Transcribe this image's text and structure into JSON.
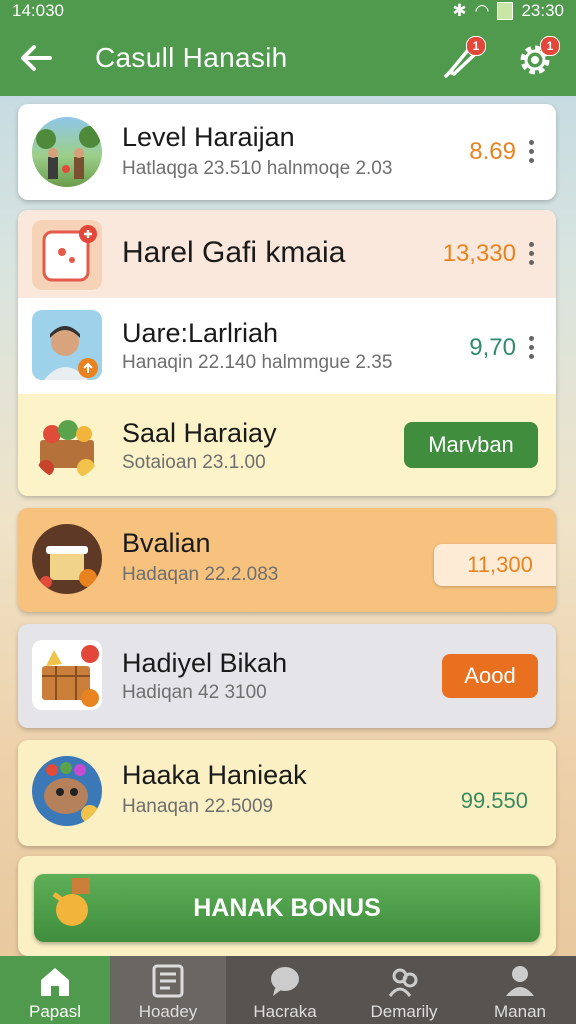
{
  "status": {
    "time": "14:030",
    "clock": "23:30"
  },
  "app": {
    "title": "Casull Hanasih"
  },
  "header_badges": {
    "bell": "1",
    "gear": "1"
  },
  "items": [
    {
      "title": "Level Haraijan",
      "subtitle": "Hatlaqga 23.510 halnmoqe 2.03",
      "value": "8.69"
    },
    {
      "title": "Harel Gafi kmaia",
      "value": "13,330"
    },
    {
      "title": "Uare:Larlriah",
      "subtitle": "Hanaqin 22.140 halmmgue 2.35",
      "value": "9,70"
    },
    {
      "title": "Saal Haraiay",
      "subtitle": "Sotaioan 23.1.00",
      "action": "Marvban"
    },
    {
      "title": "Bvalian",
      "subtitle": "Hadaqan 22.2.083",
      "value": "11,300"
    },
    {
      "title": "Hadiyel Bikah",
      "subtitle": "Hadiqan 42 3100",
      "action": "Aood"
    },
    {
      "title": "Haaka Hanieak",
      "subtitle": "Hanaqan 22.5009",
      "value": "99.550"
    }
  ],
  "bonus": {
    "label": "HANAK BONUS"
  },
  "nav": [
    {
      "label": "Papasl",
      "icon": "home-icon"
    },
    {
      "label": "Hoadey",
      "icon": "list-icon"
    },
    {
      "label": "Hacraka",
      "icon": "chat-icon"
    },
    {
      "label": "Demarily",
      "icon": "people-icon"
    },
    {
      "label": "Manan",
      "icon": "person-icon"
    }
  ],
  "colors": {
    "primary": "#4f9a4c",
    "accent": "#e8831f",
    "nav_bg": "#575350"
  }
}
